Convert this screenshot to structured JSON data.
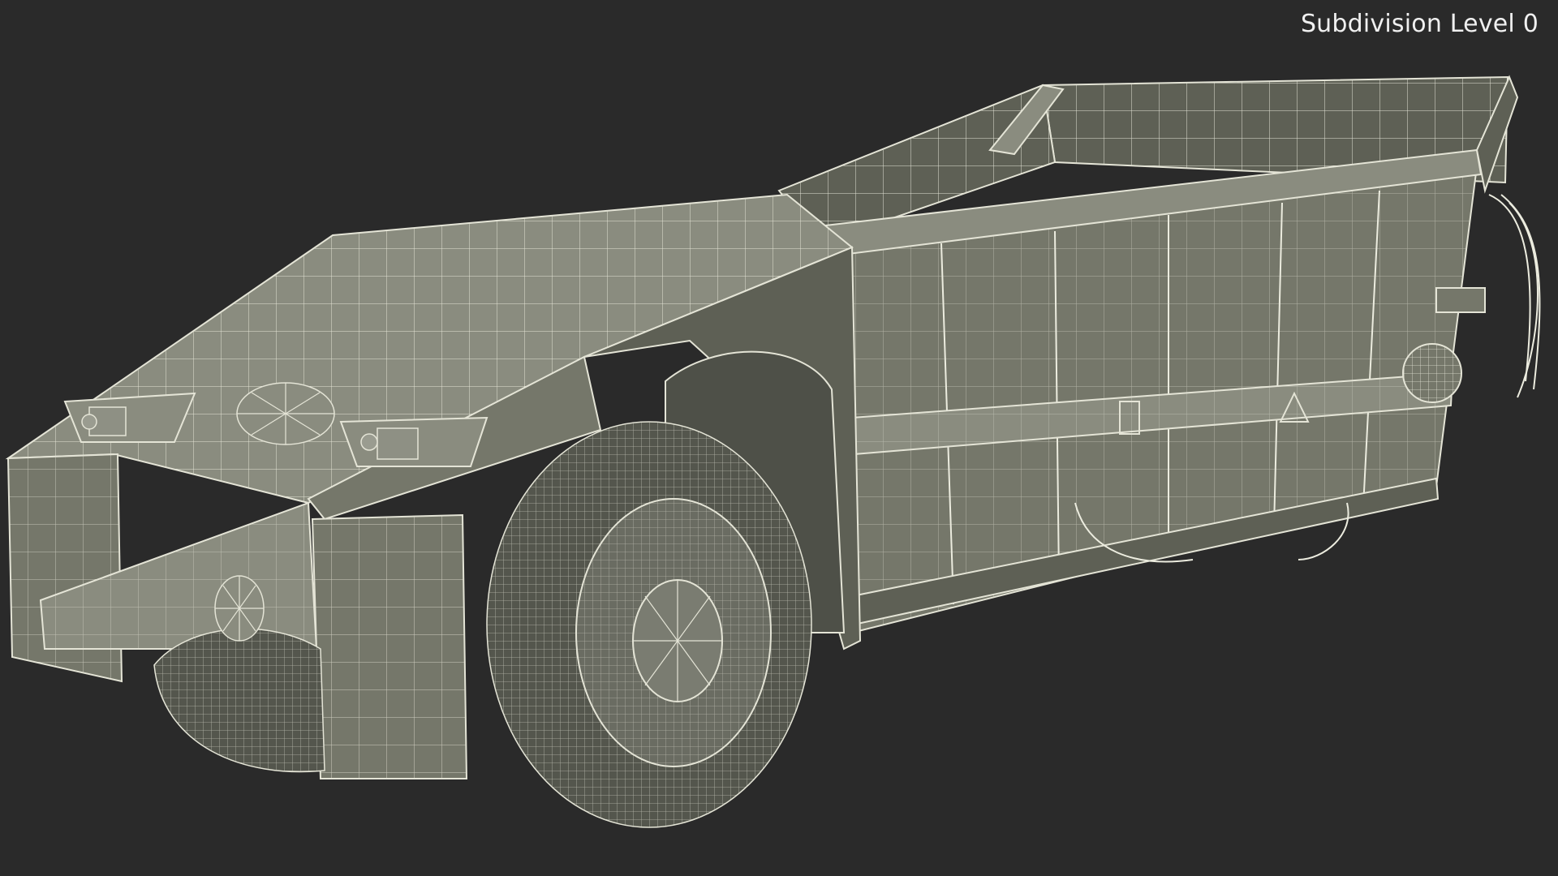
{
  "viewport": {
    "overlay_label": "Subdivision Level 0",
    "background_color": "#2a2a2a",
    "model_color": "#75776a",
    "wire_color": "#e4e4d6"
  }
}
